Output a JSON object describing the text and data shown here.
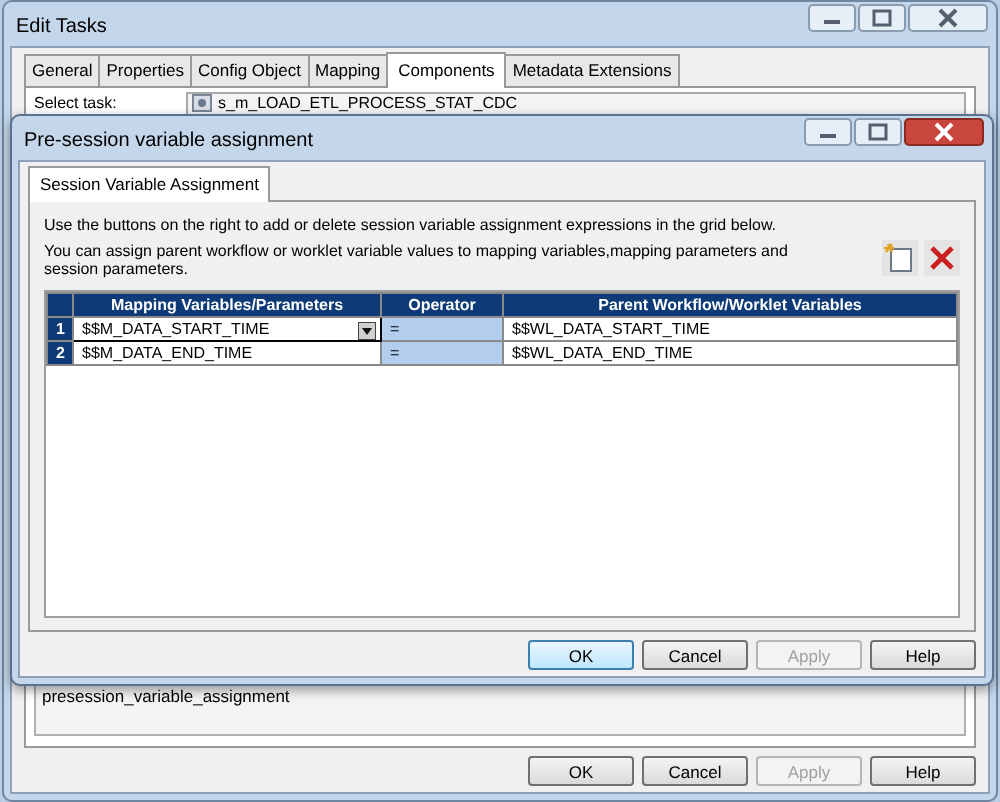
{
  "window": {
    "title": "Edit Tasks"
  },
  "tabs": [
    {
      "label": "General",
      "selected": false
    },
    {
      "label": "Properties",
      "selected": false
    },
    {
      "label": "Config Object",
      "selected": false
    },
    {
      "label": "Mapping",
      "selected": false
    },
    {
      "label": "Components",
      "selected": true
    },
    {
      "label": "Metadata Extensions",
      "selected": false
    }
  ],
  "select_task": {
    "label": "Select task:",
    "value": "s_m_LOAD_ETL_PROCESS_STAT_CDC"
  },
  "description": "presession_variable_assignment",
  "buttons": [
    {
      "label": "OK",
      "disabled": false,
      "default": false
    },
    {
      "label": "Cancel",
      "disabled": false,
      "default": false
    },
    {
      "label": "Apply",
      "disabled": true,
      "default": false
    },
    {
      "label": "Help",
      "disabled": false,
      "default": false
    }
  ],
  "dialog": {
    "title": "Pre-session variable assignment",
    "tabs": [
      {
        "label": "Session Variable Assignment",
        "selected": true
      }
    ],
    "instructions": [
      "Use the buttons on the right to add or delete session variable assignment expressions in the grid below.",
      "You can assign parent workflow or worklet variable values to mapping variables,mapping parameters and session parameters."
    ],
    "grid": {
      "columns": [
        "Mapping Variables/Parameters",
        "Operator",
        "Parent Workflow/Worklet Variables"
      ],
      "rows": [
        {
          "number": "1",
          "selected": true,
          "cells": [
            "$$M_DATA_START_TIME",
            "=",
            "$$WL_DATA_START_TIME"
          ]
        },
        {
          "number": "2",
          "selected": false,
          "cells": [
            "$$M_DATA_END_TIME",
            "=",
            "$$WL_DATA_END_TIME"
          ]
        }
      ]
    },
    "buttons": [
      {
        "label": "OK",
        "disabled": false,
        "default": true
      },
      {
        "label": "Cancel",
        "disabled": false,
        "default": false
      },
      {
        "label": "Apply",
        "disabled": true,
        "default": false
      },
      {
        "label": "Help",
        "disabled": false,
        "default": false
      }
    ]
  }
}
